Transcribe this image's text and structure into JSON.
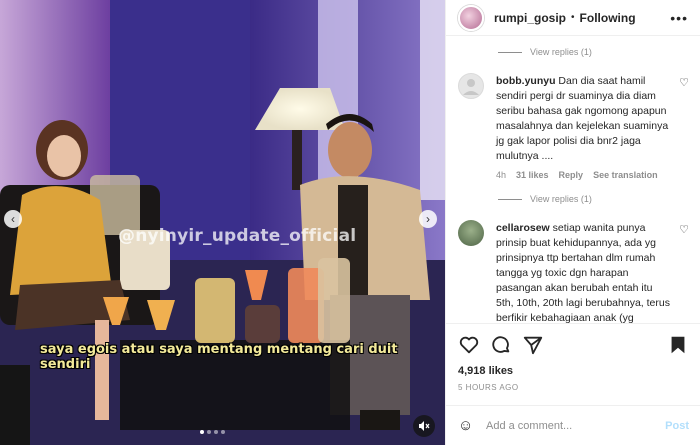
{
  "media": {
    "watermark": "@nyinyir_update_official",
    "subtitle": "saya egois atau saya mentang mentang cari duit sendiri",
    "nav_prev_icon": "chevron-left-icon",
    "nav_next_icon": "chevron-right-icon",
    "mute_icon": "speaker-muted-icon"
  },
  "header": {
    "username": "rumpi_gosip",
    "separator": "•",
    "status": "Following",
    "more": "•••"
  },
  "comments": {
    "view_replies_1": "View replies (1)",
    "items": [
      {
        "user": "bobb.yunyu",
        "text": "Dan dia saat hamil sendiri pergi dr suaminya dia diam seribu bahasa gak ngomong apapun masalahnya dan kejelekan suaminya jg gak lapor polisi dia bnr2 jaga mulutnya ....",
        "age": "4h",
        "likes": "31 likes",
        "reply": "Reply",
        "translate": "See translation"
      },
      {
        "user": "cellarosew",
        "text": "setiap wanita punya prinsip buat kehidupannya, ada yg prinsipnya ttp bertahan dlm rumah tangga yg toxic dgn harapan pasangan akan berubah entah itu 5th, 10th, 20th lagi berubahnya, terus berfikir kebahagiaan anak (yg berfikirnya anak perlu orangtua"
      }
    ],
    "view_replies_2": "View replies (1)"
  },
  "actions": {
    "likes": "4,918 likes",
    "time": "5 HOURS AGO"
  },
  "add_comment": {
    "placeholder": "Add a comment...",
    "post": "Post"
  },
  "colors": {
    "post_disabled": "#b2dffc",
    "muted_text": "#8e8e8e",
    "subtitle": "#f3ea9a"
  }
}
